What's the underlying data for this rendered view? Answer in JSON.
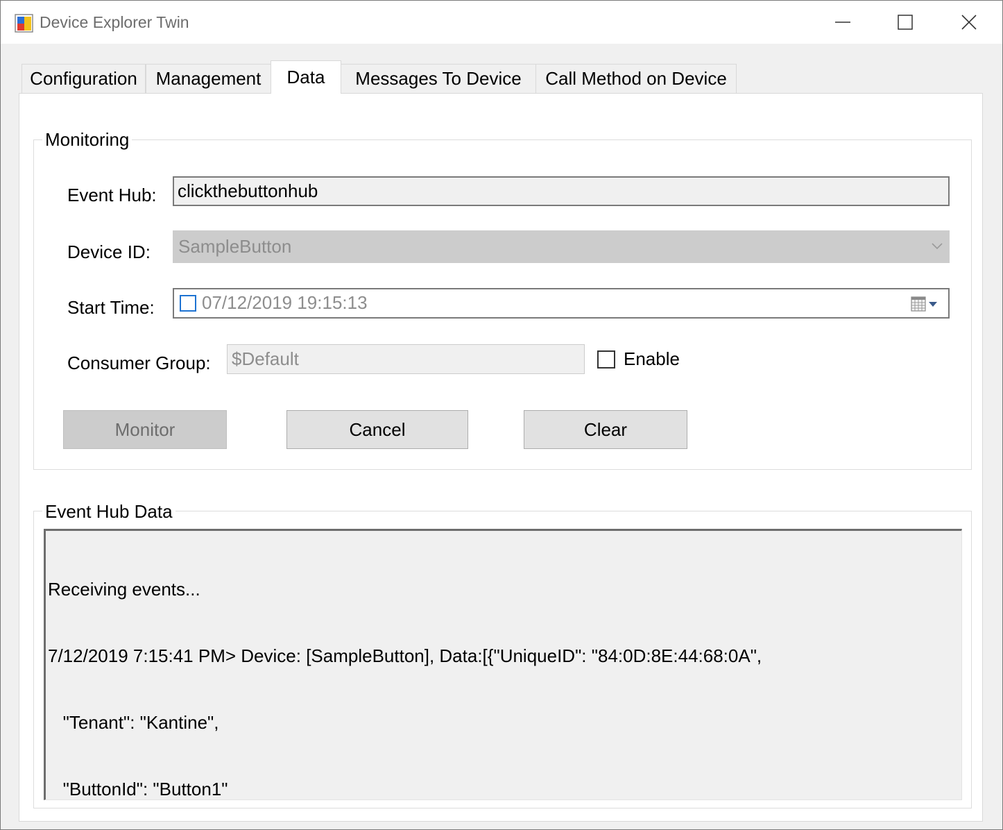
{
  "window": {
    "title": "Device Explorer Twin",
    "controls": {
      "minimize": "minimize-icon",
      "maximize": "maximize-icon",
      "close": "close-icon"
    }
  },
  "tabs": [
    {
      "label": "Configuration",
      "active": false
    },
    {
      "label": "Management",
      "active": false
    },
    {
      "label": "Data",
      "active": true
    },
    {
      "label": "Messages To Device",
      "active": false
    },
    {
      "label": "Call Method on Device",
      "active": false
    }
  ],
  "monitoring": {
    "group_title": "Monitoring",
    "event_hub_label": "Event Hub:",
    "event_hub_value": "clickthebuttonhub",
    "device_id_label": "Device ID:",
    "device_id_value": "SampleButton",
    "start_time_label": "Start Time:",
    "start_time_value": "07/12/2019 19:15:13",
    "consumer_group_label": "Consumer Group:",
    "consumer_group_value": "$Default",
    "enable_label": "Enable",
    "monitor_button": "Monitor",
    "cancel_button": "Cancel",
    "clear_button": "Clear"
  },
  "event_hub_data": {
    "group_title": "Event Hub Data",
    "lines": [
      "Receiving events...",
      "7/12/2019 7:15:41 PM> Device: [SampleButton], Data:[{\"UniqueID\": \"84:0D:8E:44:68:0A\",",
      "   \"Tenant\": \"Kantine\",",
      "   \"ButtonId\": \"Button1\"",
      "}]"
    ]
  },
  "colors": {
    "window_bg": "#f0f0f0",
    "tab_page_bg": "#ffffff",
    "checkbox_accent": "#1e73d2",
    "disabled_text": "#8d8d8d"
  }
}
